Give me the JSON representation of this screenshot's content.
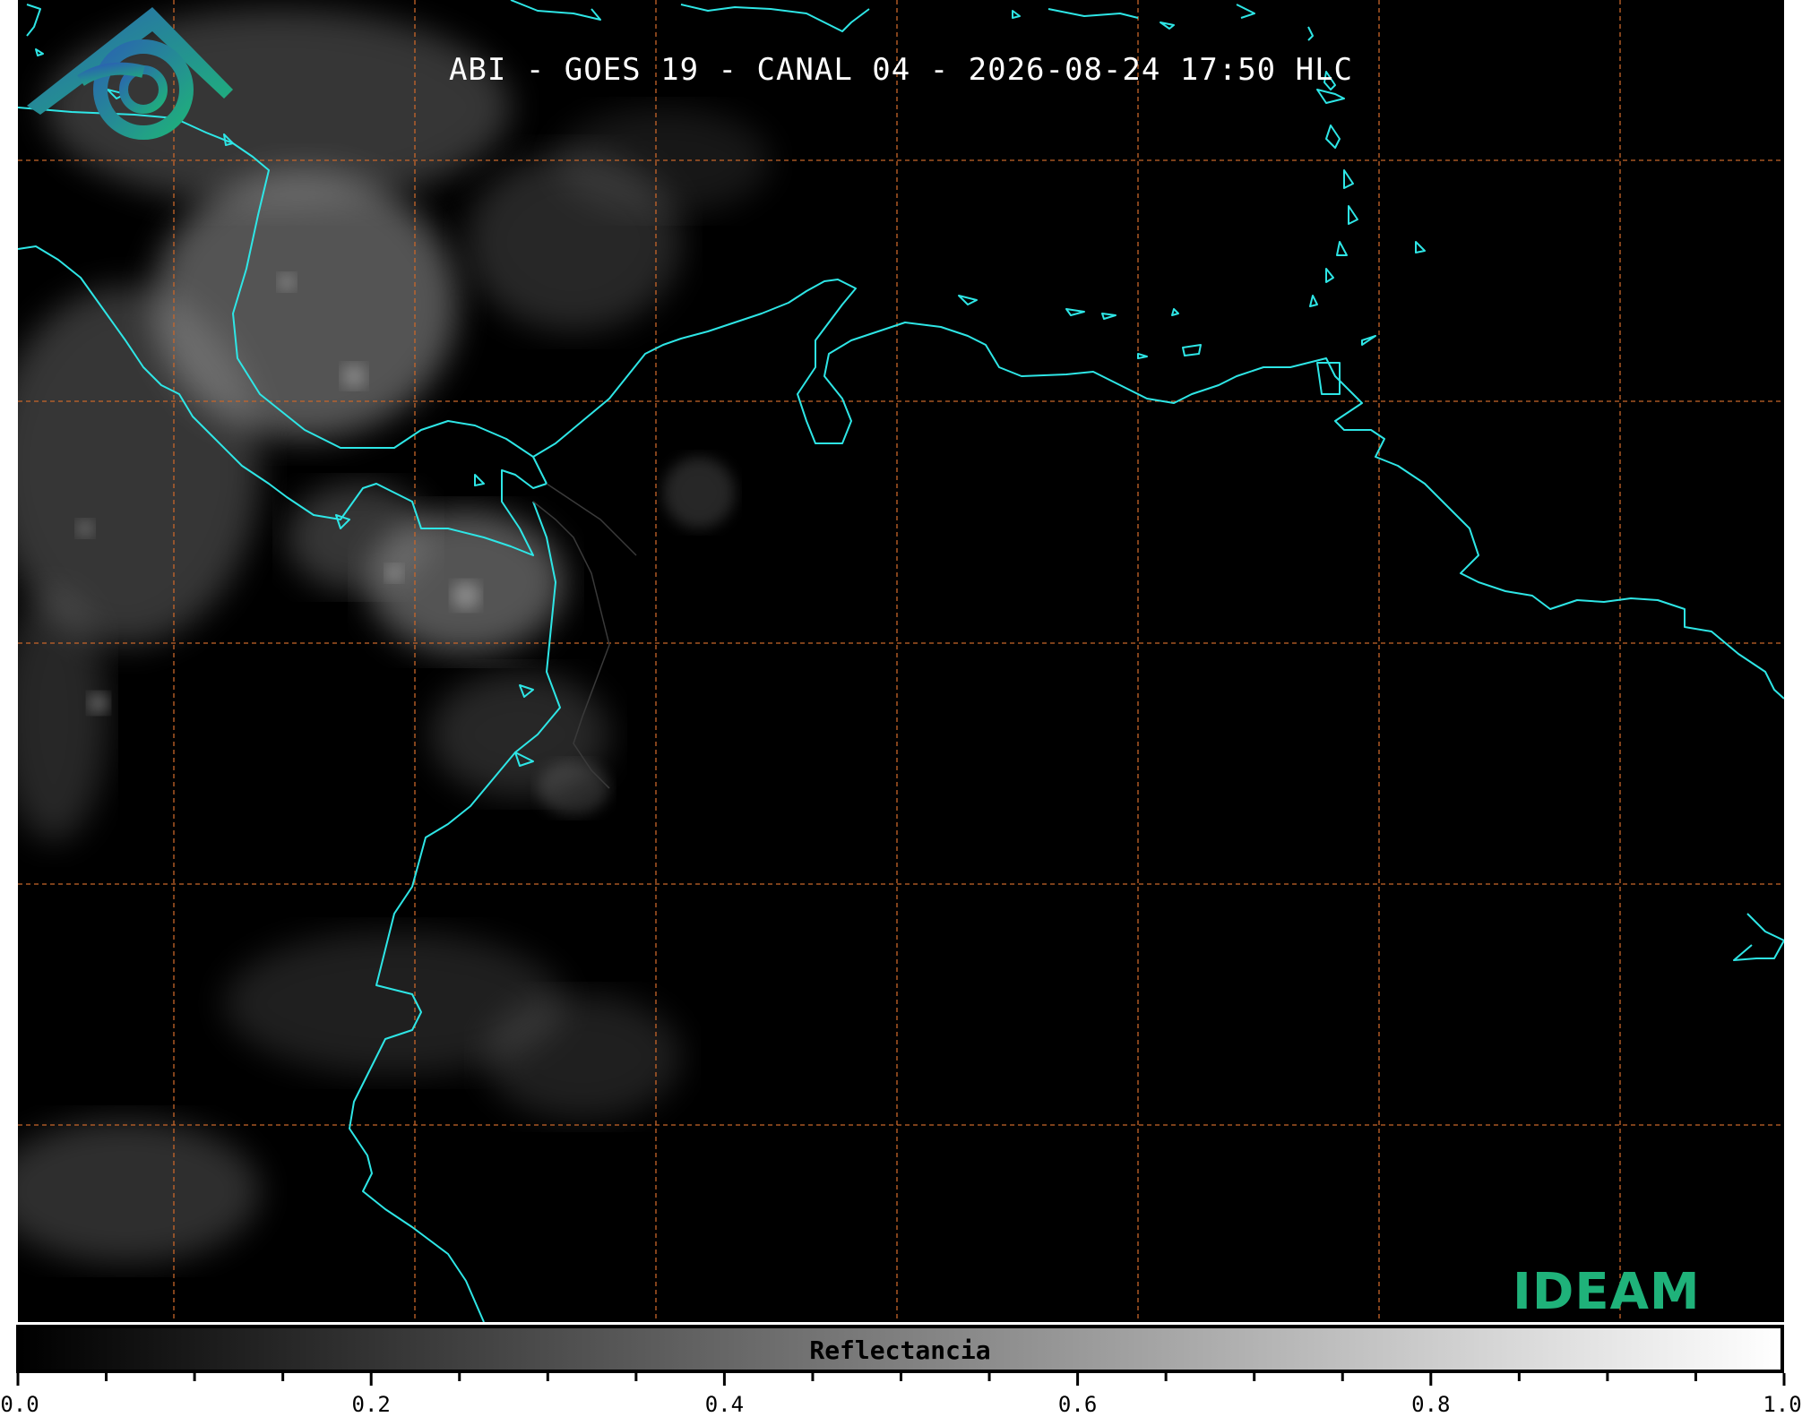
{
  "title": "ABI - GOES 19 - CANAL 04 - 2026-08-24 17:50 HLC",
  "colorbar": {
    "label": "Reflectancia",
    "min": 0.0,
    "max": 1.0,
    "ticks": [
      "0.0",
      "0.2",
      "0.4",
      "0.6",
      "0.8",
      "1.0"
    ],
    "minor_ticks": 20
  },
  "logo": {
    "text": "IDEAM",
    "color": "#1fb27a"
  },
  "colors": {
    "coastline": "#2ee6e6",
    "grid": "#c8662a",
    "background": "#000000"
  }
}
